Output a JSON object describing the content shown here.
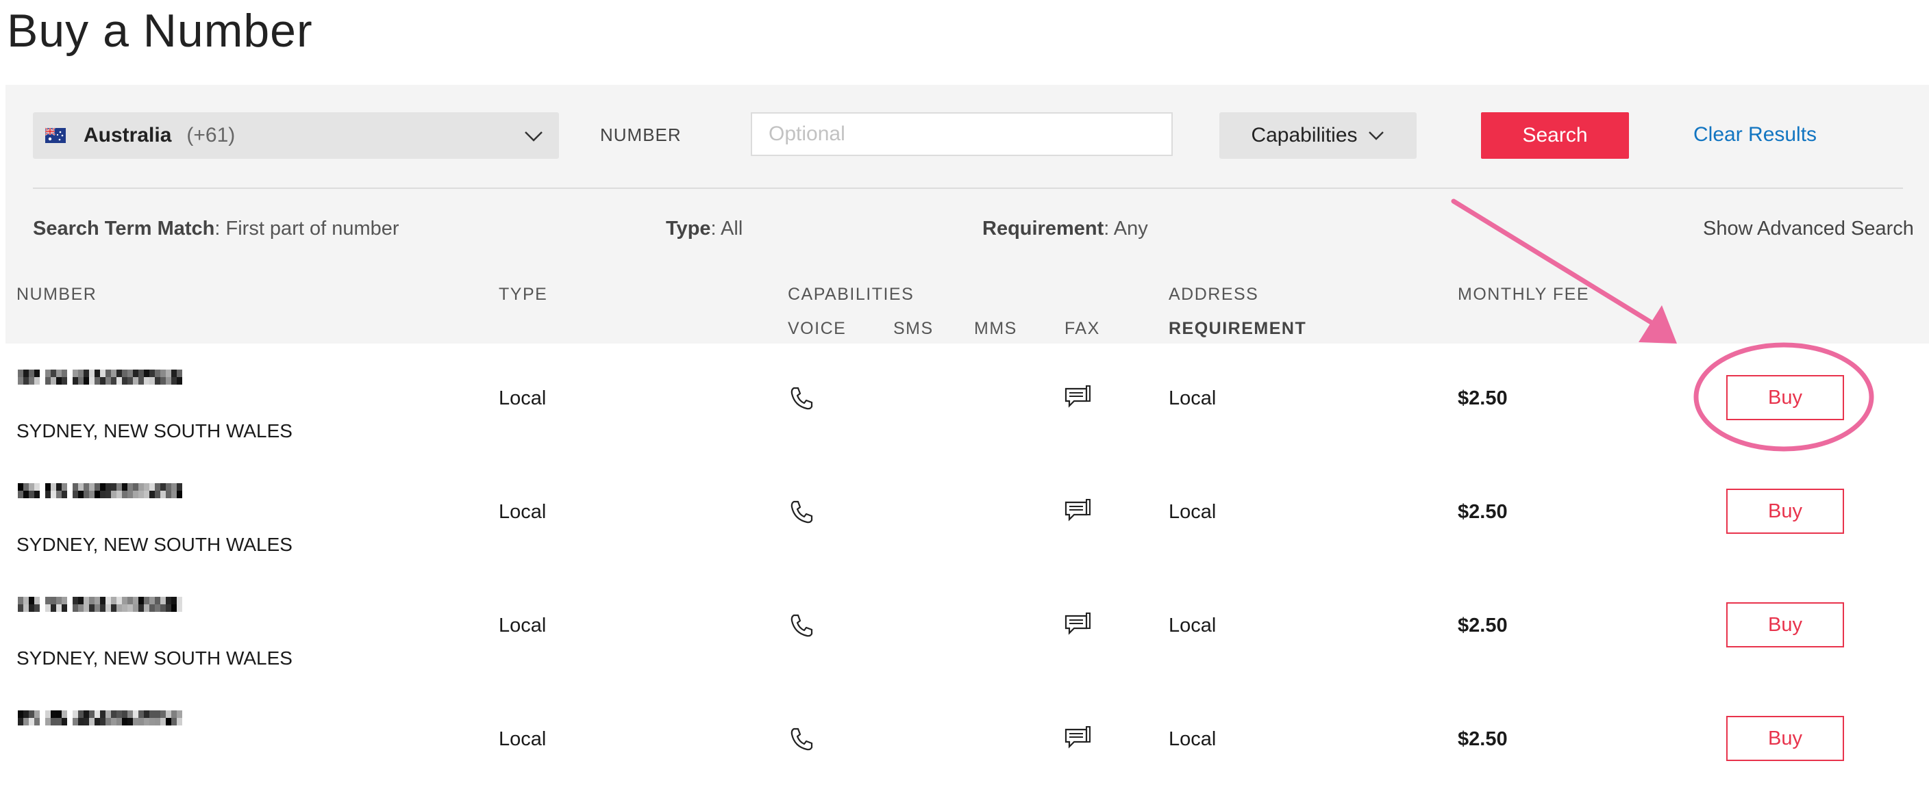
{
  "page": {
    "title": "Buy a Number"
  },
  "search": {
    "country_name": "Australia",
    "country_code": "(+61)",
    "number_label": "NUMBER",
    "number_placeholder": "Optional",
    "number_value": "",
    "capabilities_label": "Capabilities",
    "search_label": "Search",
    "clear_label": "Clear Results"
  },
  "filters": {
    "match_label": "Search Term Match",
    "match_value": ": First part of number",
    "type_label": "Type",
    "type_value": ": All",
    "requirement_label": "Requirement",
    "requirement_value": ": Any",
    "advanced_label": "Show Advanced Search"
  },
  "table": {
    "headers": {
      "number": "NUMBER",
      "type": "TYPE",
      "capabilities": "CAPABILITIES",
      "voice": "VOICE",
      "sms": "SMS",
      "mms": "MMS",
      "fax": "FAX",
      "address": "ADDRESS",
      "requirement": "REQUIREMENT",
      "monthly_fee": "MONTHLY FEE"
    },
    "rows": [
      {
        "location": "SYDNEY, NEW SOUTH WALES",
        "type": "Local",
        "address": "Local",
        "fee": "$2.50",
        "buy": "Buy"
      },
      {
        "location": "SYDNEY, NEW SOUTH WALES",
        "type": "Local",
        "address": "Local",
        "fee": "$2.50",
        "buy": "Buy"
      },
      {
        "location": "SYDNEY, NEW SOUTH WALES",
        "type": "Local",
        "address": "Local",
        "fee": "$2.50",
        "buy": "Buy"
      },
      {
        "location": "",
        "type": "Local",
        "address": "Local",
        "fee": "$2.50",
        "buy": "Buy"
      }
    ]
  },
  "colors": {
    "accent": "#ee2e4a",
    "link": "#1275c1",
    "annotation": "#ec6a9e",
    "panel": "#f4f4f4"
  },
  "icons": {
    "flag": "australia-flag-icon",
    "dropdown": "chevron-down-icon",
    "voice": "phone-icon",
    "fax": "fax-icon"
  }
}
